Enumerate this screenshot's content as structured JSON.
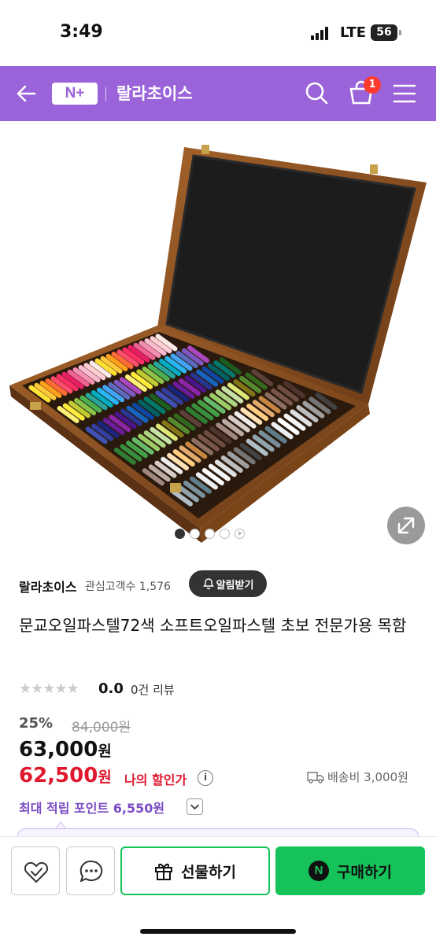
{
  "status_bar": {
    "time": "3:49",
    "network": "LTE",
    "battery": "56"
  },
  "header": {
    "logo": "N+",
    "store_name": "랄라초이스",
    "cart_count": "1"
  },
  "gallery": {
    "total_images": 5,
    "current_index": 1
  },
  "product": {
    "seller": "랄라초이스",
    "fans": "관심고객수 1,576",
    "notify_label": "알림받기",
    "title": "문교오일파스텔72색 소프트오일파스텔 초보 전문가용 목함",
    "stars": "★★★★★",
    "rating": "0.0",
    "reviews": "0건 리뷰",
    "discount": "25%",
    "original_price": "84,000원",
    "price": "63,000",
    "price_unit": "원",
    "my_price": "62,500",
    "my_price_unit": "원",
    "my_price_label": "나의 할인가",
    "info_mark": "i",
    "shipping_fee": "배송비 3,000원",
    "points": "최대 적립 포인트 6,550원"
  },
  "bottom_bar": {
    "gift_label": "선물하기",
    "buy_label": "구매하기",
    "npay_mark": "N"
  },
  "colors": {
    "brand_purple": "#9a63d9",
    "price_red": "#e0182e",
    "buy_green": "#16c25a",
    "points_purple": "#7a4bc4"
  }
}
